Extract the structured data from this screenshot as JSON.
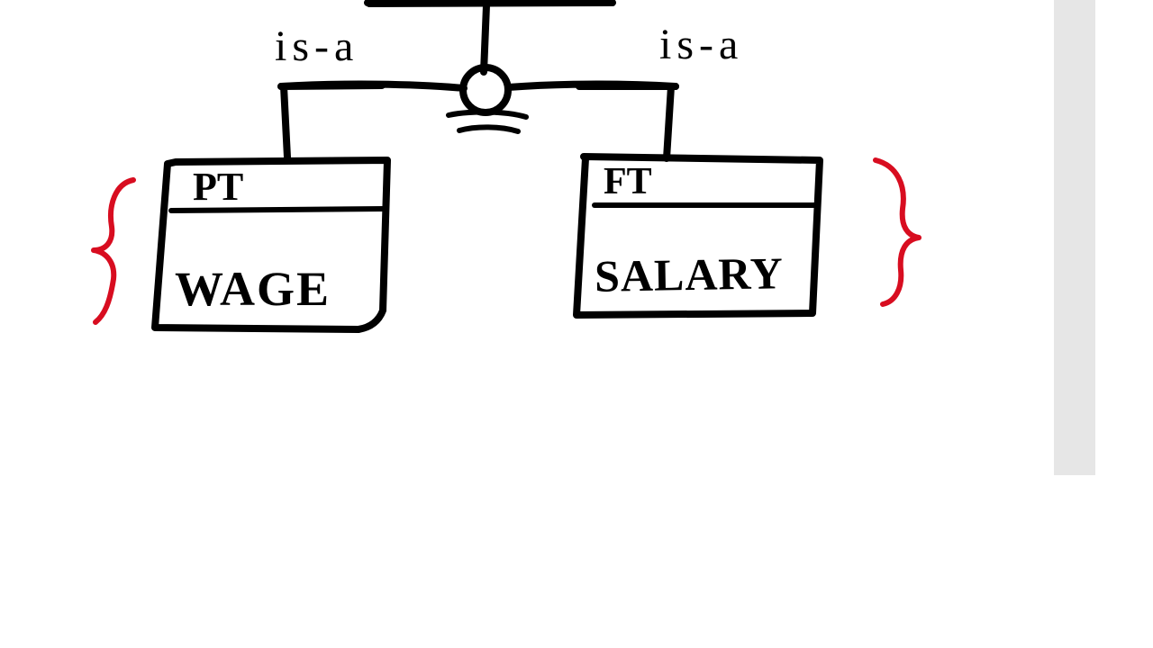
{
  "diagram": {
    "relation_left": "is-a",
    "relation_right": "is-a",
    "left": {
      "title": "PT",
      "attr": "WAGE"
    },
    "right": {
      "title": "FT",
      "attr": "SALARY"
    }
  }
}
